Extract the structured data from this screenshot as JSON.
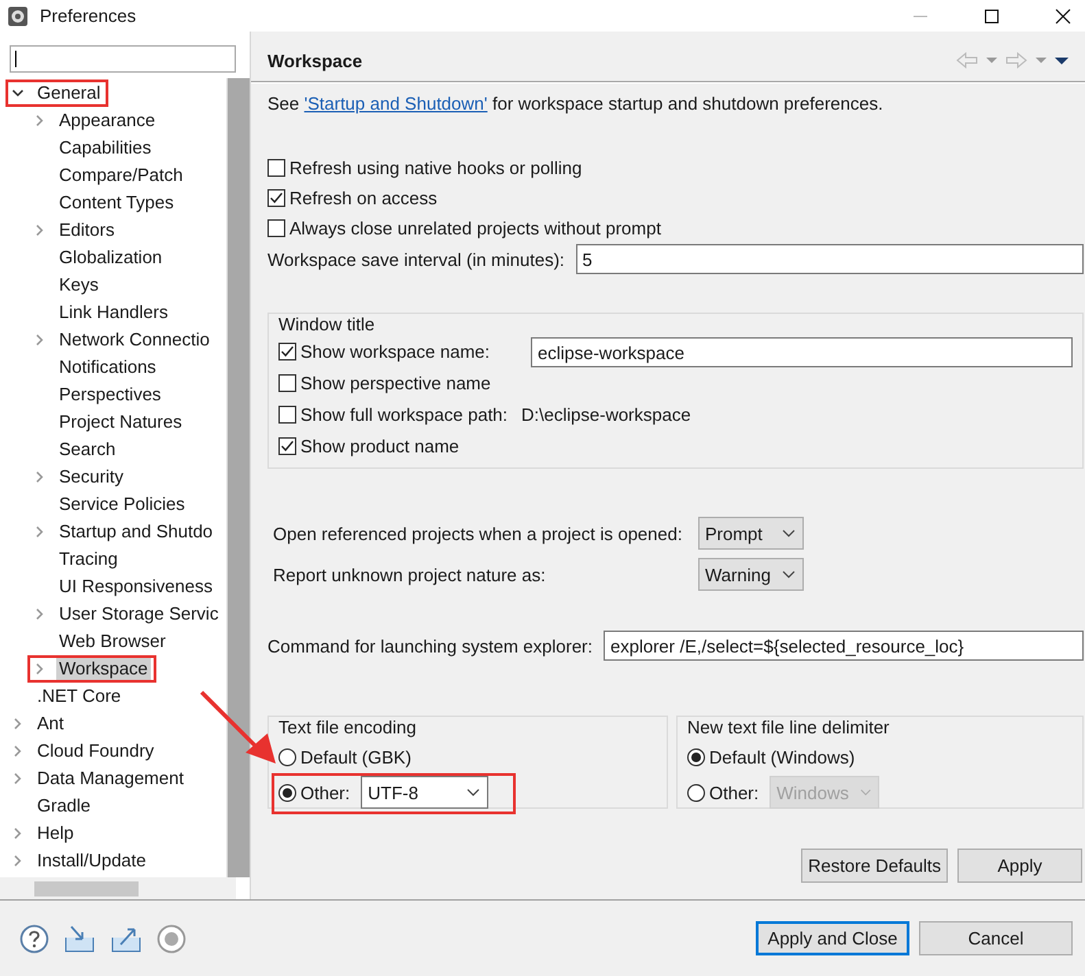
{
  "window": {
    "title": "Preferences"
  },
  "tree": [
    {
      "label": "General",
      "expanded": true,
      "selected": false,
      "annotated": true,
      "children": [
        {
          "label": "Appearance",
          "expanded": false,
          "selected": false,
          "annotated": false
        },
        {
          "label": "Capabilities",
          "selected": false,
          "annotated": false
        },
        {
          "label": "Compare/Patch",
          "selected": false,
          "annotated": false
        },
        {
          "label": "Content Types",
          "selected": false,
          "annotated": false
        },
        {
          "label": "Editors",
          "expanded": false,
          "selected": false,
          "annotated": false
        },
        {
          "label": "Globalization",
          "selected": false,
          "annotated": false
        },
        {
          "label": "Keys",
          "selected": false,
          "annotated": false
        },
        {
          "label": "Link Handlers",
          "selected": false,
          "annotated": false
        },
        {
          "label": "Network Connectio",
          "expanded": false,
          "selected": false,
          "annotated": false
        },
        {
          "label": "Notifications",
          "selected": false,
          "annotated": false
        },
        {
          "label": "Perspectives",
          "selected": false,
          "annotated": false
        },
        {
          "label": "Project Natures",
          "selected": false,
          "annotated": false
        },
        {
          "label": "Search",
          "selected": false,
          "annotated": false
        },
        {
          "label": "Security",
          "expanded": false,
          "selected": false,
          "annotated": false
        },
        {
          "label": "Service Policies",
          "selected": false,
          "annotated": false
        },
        {
          "label": "Startup and Shutdo",
          "expanded": false,
          "selected": false,
          "annotated": false
        },
        {
          "label": "Tracing",
          "selected": false,
          "annotated": false
        },
        {
          "label": "UI Responsiveness",
          "selected": false,
          "annotated": false
        },
        {
          "label": "User Storage Servic",
          "expanded": false,
          "selected": false,
          "annotated": false
        },
        {
          "label": "Web Browser",
          "selected": false,
          "annotated": false
        },
        {
          "label": "Workspace",
          "expanded": false,
          "selected": true,
          "annotated": true
        }
      ]
    },
    {
      "label": ".NET Core",
      "selected": false,
      "annotated": false
    },
    {
      "label": "Ant",
      "expanded": false,
      "selected": false,
      "annotated": false
    },
    {
      "label": "Cloud Foundry",
      "expanded": false,
      "selected": false,
      "annotated": false
    },
    {
      "label": "Data Management",
      "expanded": false,
      "selected": false,
      "annotated": false
    },
    {
      "label": "Gradle",
      "selected": false,
      "annotated": false
    },
    {
      "label": "Help",
      "expanded": false,
      "selected": false,
      "annotated": false
    },
    {
      "label": "Install/Update",
      "expanded": false,
      "selected": false,
      "annotated": false
    }
  ],
  "page": {
    "title": "Workspace",
    "intro": {
      "before": "See ",
      "link": "'Startup and Shutdown'",
      "after": " for workspace startup and shutdown preferences."
    },
    "options": [
      {
        "label": "Refresh using native hooks or polling",
        "checked": false
      },
      {
        "label": "Refresh on access",
        "checked": true
      },
      {
        "label": "Always close unrelated projects without prompt",
        "checked": false
      }
    ],
    "save_interval": {
      "label": "Workspace save interval (in minutes):",
      "value": "5"
    },
    "window_title": {
      "title": "Window title",
      "options": [
        {
          "kind": "field",
          "label": "Show workspace name:",
          "checked": true,
          "value": "eclipse-workspace"
        },
        {
          "kind": "plain",
          "label": "Show perspective name",
          "checked": false
        },
        {
          "kind": "path",
          "label": "Show full workspace path:",
          "checked": false,
          "value": "D:\\eclipse-workspace"
        },
        {
          "kind": "plain",
          "label": "Show product name",
          "checked": true
        }
      ]
    },
    "combos": [
      {
        "label": "Open referenced projects when a project is opened:",
        "value": "Prompt"
      },
      {
        "label": "Report unknown project nature as:",
        "value": "Warning"
      }
    ],
    "explorer": {
      "label": "Command for launching system explorer:",
      "value": "explorer /E,/select=${selected_resource_loc}"
    },
    "encoding": {
      "title": "Text file encoding",
      "options": [
        {
          "kind": "plain",
          "label": "Default (GBK)",
          "selected": false,
          "annotated": false
        },
        {
          "kind": "combo",
          "label": "Other:",
          "selected": true,
          "value": "UTF-8",
          "disabled": false,
          "annotated": true
        }
      ]
    },
    "delimiter": {
      "title": "New text file line delimiter",
      "options": [
        {
          "kind": "plain",
          "label": "Default (Windows)",
          "selected": true,
          "annotated": false
        },
        {
          "kind": "combo",
          "label": "Other:",
          "selected": false,
          "value": "Windows",
          "disabled": true,
          "annotated": false
        }
      ]
    },
    "page_buttons": [
      "Restore Defaults",
      "Apply"
    ]
  },
  "buttons": [
    {
      "label": "Apply and Close",
      "default": true
    },
    {
      "label": "Cancel",
      "default": false
    }
  ]
}
